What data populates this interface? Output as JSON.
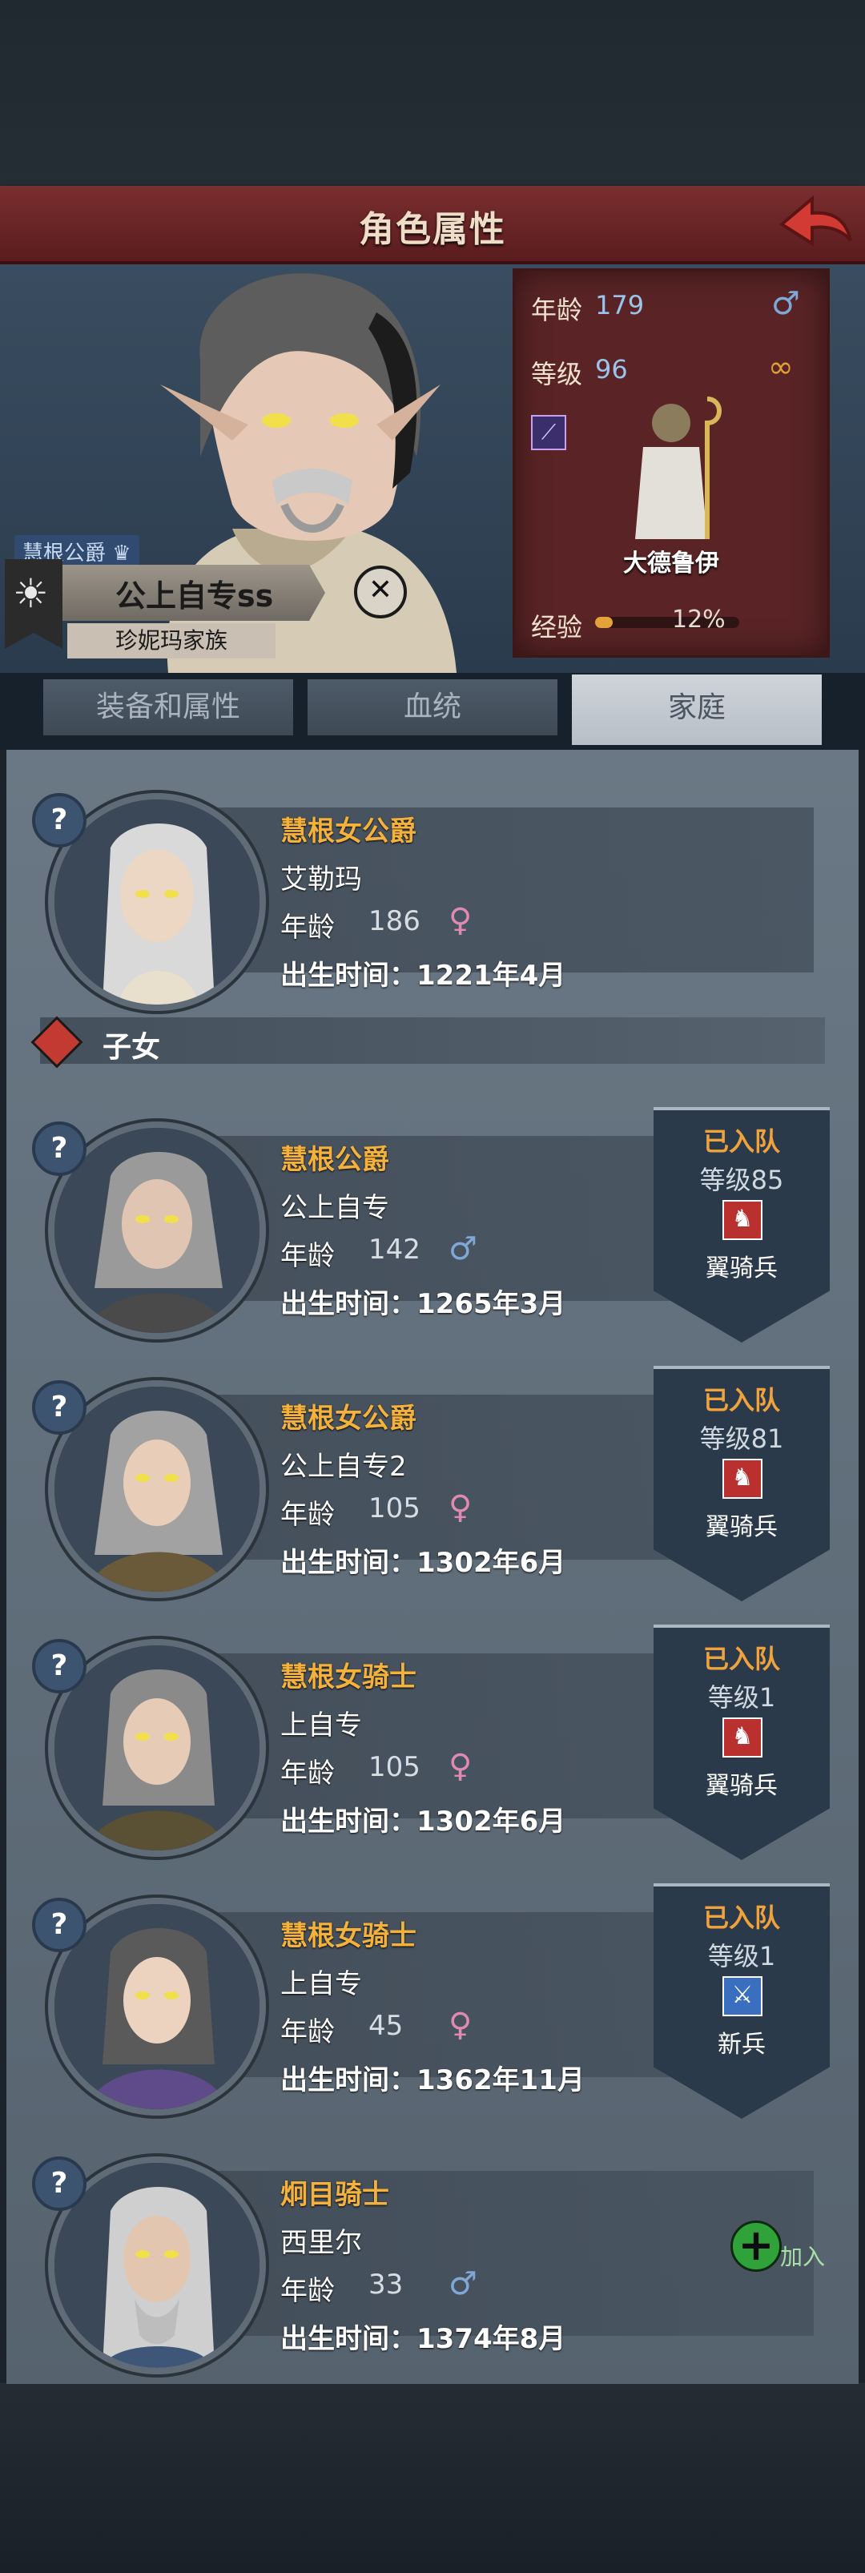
{
  "header": {
    "title": "角色属性",
    "character_title": "慧根公爵",
    "character_name": "公上自专ss",
    "family_name": "珍妮玛家族",
    "stats": {
      "age_label": "年龄",
      "age_value": "179",
      "level_label": "等级",
      "level_value": "96",
      "class_name": "大德鲁伊",
      "exp_label": "经验",
      "exp_percent_text": "12%",
      "exp_fraction": 0.12
    }
  },
  "tabs": [
    "装备和属性",
    "血统",
    "家庭"
  ],
  "spouse": {
    "rank": "慧根女公爵",
    "name": "艾勒玛",
    "age_label": "年龄",
    "age": "186",
    "gender": "female",
    "birth": "出生时间：1221年4月"
  },
  "children_section_label": "子女",
  "children": [
    {
      "rank": "慧根公爵",
      "name": "公上自专",
      "age_label": "年龄",
      "age": "142",
      "gender": "male",
      "birth": "出生时间：1265年3月",
      "status": "已入队",
      "level": "等级85",
      "unit": "翼骑兵",
      "unit_icon": "horse-icon"
    },
    {
      "rank": "慧根女公爵",
      "name": "公上自专2",
      "age_label": "年龄",
      "age": "105",
      "gender": "female",
      "birth": "出生时间：1302年6月",
      "status": "已入队",
      "level": "等级81",
      "unit": "翼骑兵",
      "unit_icon": "horse-icon"
    },
    {
      "rank": "慧根女骑士",
      "name": "上自专",
      "age_label": "年龄",
      "age": "105",
      "gender": "female",
      "birth": "出生时间：1302年6月",
      "status": "已入队",
      "level": "等级1",
      "unit": "翼骑兵",
      "unit_icon": "horse-icon"
    },
    {
      "rank": "慧根女骑士",
      "name": "上自专",
      "age_label": "年龄",
      "age": "45",
      "gender": "female",
      "birth": "出生时间：1362年11月",
      "status": "已入队",
      "level": "等级1",
      "unit": "新兵",
      "unit_icon": "sword-icon"
    },
    {
      "rank": "炯目骑士",
      "name": "西里尔",
      "age_label": "年龄",
      "age": "33",
      "gender": "male",
      "birth": "出生时间：1374年8月",
      "add_label": "加入"
    }
  ],
  "colors": {
    "rank": "#f4b23c",
    "status": "#f0a33c",
    "male": "#7fa8d8",
    "female": "#e08ab0",
    "add": "#2fa33a"
  }
}
